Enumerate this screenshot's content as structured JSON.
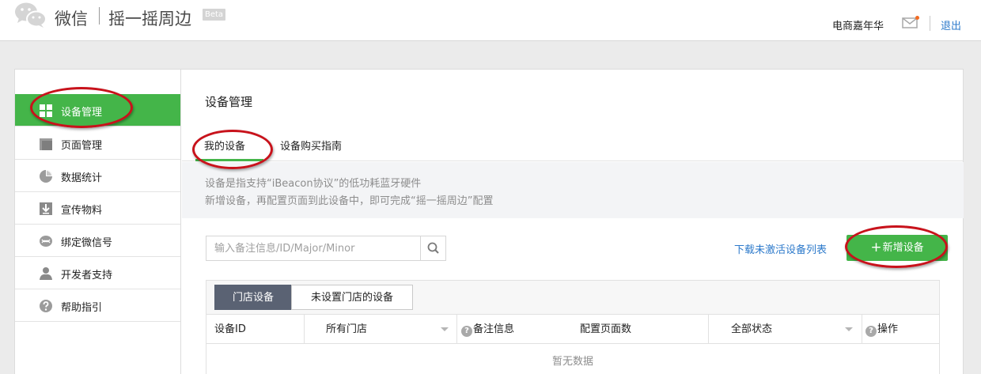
{
  "header": {
    "brand": "微信",
    "product": "摇一摇周边",
    "badge": "Beta",
    "user_name": "电商嘉年华",
    "logout_label": "退出"
  },
  "sidebar": {
    "items": [
      {
        "label": "设备管理",
        "icon": "grid-icon",
        "active": true
      },
      {
        "label": "页面管理",
        "icon": "folder-icon"
      },
      {
        "label": "数据统计",
        "icon": "pie-chart-icon"
      },
      {
        "label": "宣传物料",
        "icon": "download-icon"
      },
      {
        "label": "绑定微信号",
        "icon": "link-icon"
      },
      {
        "label": "开发者支持",
        "icon": "user-icon"
      },
      {
        "label": "帮助指引",
        "icon": "help-icon"
      }
    ]
  },
  "main": {
    "title": "设备管理",
    "tabs": [
      {
        "label": "我的设备",
        "active": true
      },
      {
        "label": "设备购买指南"
      }
    ],
    "notice": [
      "设备是指支持“iBeacon协议”的低功耗蓝牙硬件",
      "新增设备，再配置页面到此设备中，即可完成“摇一摇周边”配置"
    ],
    "search": {
      "placeholder": "输入备注信息/ID/Major/Minor",
      "value": ""
    },
    "download_link": "下载未激活设备列表",
    "add_button": "新增设备",
    "sub_tabs": [
      {
        "label": "门店设备",
        "active": true
      },
      {
        "label": "未设置门店的设备"
      }
    ],
    "table": {
      "columns": [
        "设备ID",
        "所有门店",
        "备注信息",
        "配置页面数",
        "全部状态",
        "操作"
      ],
      "empty_text": "暂无数据"
    }
  },
  "colors": {
    "accent_green": "#44b549",
    "link_blue": "#2d7acb",
    "annotation_red": "#c8121b",
    "sub_tab_active": "#5a6273"
  }
}
